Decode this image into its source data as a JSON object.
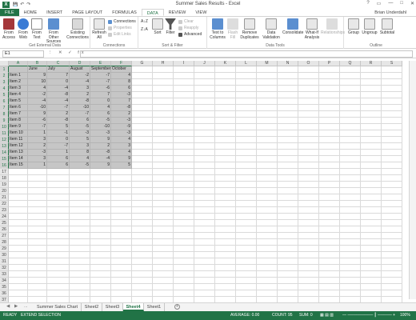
{
  "window": {
    "title": "Summer Sales Results - Excel",
    "user": "Brian Underdahl",
    "controls": [
      "?",
      "▭",
      "—",
      "□",
      "✕"
    ]
  },
  "qat": {
    "save": "💾",
    "undo": "↶",
    "redo": "↷"
  },
  "tabs": [
    "FILE",
    "HOME",
    "INSERT",
    "PAGE LAYOUT",
    "FORMULAS",
    "DATA",
    "REVIEW",
    "VIEW"
  ],
  "ribbon": {
    "get_external": {
      "label": "Get External Data",
      "from_access": "From Access",
      "from_web": "From Web",
      "from_text": "From Text",
      "from_other": "From Other Sources",
      "existing": "Existing Connections"
    },
    "connections": {
      "label": "Connections",
      "refresh": "Refresh All",
      "connections": "Connections",
      "properties": "Properties",
      "edit_links": "Edit Links"
    },
    "sort_filter": {
      "label": "Sort & Filter",
      "sort_az": "A↓Z",
      "sort_za": "Z↓A",
      "sort": "Sort",
      "filter": "Filter",
      "clear": "Clear",
      "reapply": "Reapply",
      "advanced": "Advanced"
    },
    "data_tools": {
      "label": "Data Tools",
      "text_to_columns": "Text to Columns",
      "flash_fill": "Flash Fill",
      "remove_dup": "Remove Duplicates",
      "validation": "Data Validation",
      "consolidate": "Consolidate",
      "whatif": "What-If Analysis",
      "relationships": "Relationships"
    },
    "outline": {
      "label": "Outline",
      "group": "Group",
      "ungroup": "Ungroup",
      "subtotal": "Subtotal"
    }
  },
  "formula_bar": {
    "name_box": "E1",
    "icons": "⋮ ✕ ✓ fx",
    "value": ""
  },
  "grid": {
    "columns": [
      "A",
      "B",
      "C",
      "D",
      "E",
      "F",
      "G",
      "H",
      "I",
      "J",
      "K",
      "L",
      "M",
      "N",
      "O",
      "P",
      "Q",
      "R",
      "S"
    ],
    "row_count": 37,
    "headers": [
      "",
      "June",
      "July",
      "August",
      "September",
      "October"
    ],
    "rows": [
      [
        "Item 1",
        "9",
        "7",
        "-2",
        "-7",
        "4"
      ],
      [
        "Item 2",
        "10",
        "0",
        "-4",
        "-7",
        "8"
      ],
      [
        "Item 3",
        "4",
        "-4",
        "3",
        "-6",
        "6"
      ],
      [
        "Item 4",
        "-2",
        "-8",
        "2",
        "7",
        "-3"
      ],
      [
        "Item 5",
        "-4",
        "-4",
        "-8",
        "0",
        "7"
      ],
      [
        "Item 6",
        "-10",
        "-7",
        "-10",
        "4",
        "-8"
      ],
      [
        "Item 7",
        "9",
        "2",
        "-7",
        "6",
        "2"
      ],
      [
        "Item 8",
        "-6",
        "-8",
        "6",
        "-5",
        "-3"
      ],
      [
        "Item 9",
        "-7",
        "5",
        "-5",
        "-10",
        "-9"
      ],
      [
        "Item 10",
        "1",
        "-1",
        "-3",
        "-3",
        "-3"
      ],
      [
        "Item 11",
        "3",
        "0",
        "5",
        "9",
        "4"
      ],
      [
        "Item 12",
        "2",
        "-7",
        "3",
        "2",
        "3"
      ],
      [
        "Item 13",
        "-3",
        "1",
        "8",
        "-8",
        "4"
      ],
      [
        "Item 14",
        "3",
        "6",
        "4",
        "-4",
        "9"
      ],
      [
        "Item 15",
        "1",
        "6",
        "-5",
        "9",
        "5"
      ]
    ]
  },
  "sheets": {
    "nav": [
      "◀",
      "▶",
      "..."
    ],
    "tabs": [
      "Summer Sales Chart",
      "Sheet2",
      "Sheet3",
      "Sheet4",
      "Sheet1"
    ],
    "active": "Sheet4",
    "add": "+"
  },
  "status": {
    "ready": "READY",
    "mode": "EXTEND SELECTION",
    "average": "AVERAGE: 0.00",
    "count": "COUNT: 95",
    "sum": "SUM: 0",
    "zoom": "100%"
  },
  "colors": {
    "accent": "#217346",
    "selection": "#c6c6c6"
  }
}
